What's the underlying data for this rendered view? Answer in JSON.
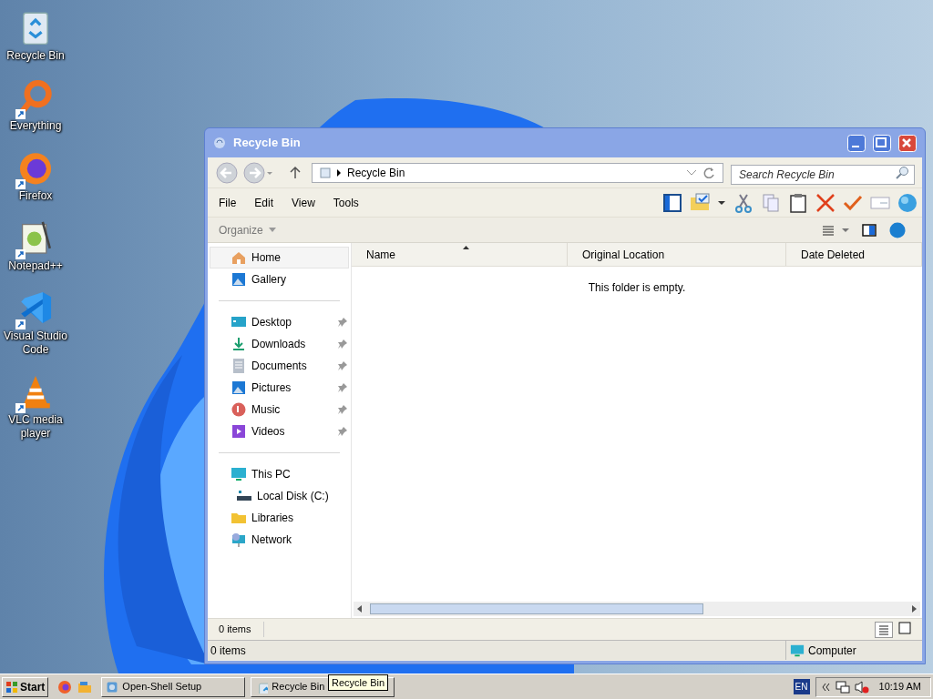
{
  "desktop_icons": [
    {
      "label": "Recycle Bin",
      "kind": "bin",
      "shortcut": false
    },
    {
      "label": "Everything",
      "kind": "magnifier",
      "shortcut": true
    },
    {
      "label": "Firefox",
      "kind": "firefox",
      "shortcut": true
    },
    {
      "label": "Notepad++",
      "kind": "notepad",
      "shortcut": true
    },
    {
      "label": "Visual Studio Code",
      "kind": "vscode",
      "shortcut": true
    },
    {
      "label": "VLC media player",
      "kind": "cone",
      "shortcut": true
    }
  ],
  "window": {
    "title": "Recycle Bin",
    "address": {
      "path": "Recycle Bin"
    },
    "search": {
      "placeholder": "Search Recycle Bin"
    },
    "menu": [
      "File",
      "Edit",
      "View",
      "Tools"
    ],
    "command_bar": {
      "organize": "Organize"
    },
    "nav_groups": [
      [
        {
          "label": "Home",
          "kind": "home",
          "selected": true,
          "pinned": false
        },
        {
          "label": "Gallery",
          "kind": "gallery",
          "selected": false,
          "pinned": false
        }
      ],
      [
        {
          "label": "Desktop",
          "kind": "desktop",
          "selected": false,
          "pinned": true
        },
        {
          "label": "Downloads",
          "kind": "download",
          "selected": false,
          "pinned": true
        },
        {
          "label": "Documents",
          "kind": "doc",
          "selected": false,
          "pinned": true
        },
        {
          "label": "Pictures",
          "kind": "gallery",
          "selected": false,
          "pinned": true
        },
        {
          "label": "Music",
          "kind": "music",
          "selected": false,
          "pinned": true
        },
        {
          "label": "Videos",
          "kind": "video",
          "selected": false,
          "pinned": true
        }
      ],
      [
        {
          "label": "This PC",
          "kind": "pc",
          "selected": false,
          "pinned": false,
          "children": [
            {
              "label": "Local Disk (C:)",
              "kind": "disk",
              "selected": false,
              "pinned": false
            }
          ]
        },
        {
          "label": "Libraries",
          "kind": "folder",
          "selected": false,
          "pinned": false
        },
        {
          "label": "Network",
          "kind": "network",
          "selected": false,
          "pinned": false
        }
      ]
    ],
    "table": {
      "columns": [
        "Name",
        "Original Location",
        "Date Deleted"
      ],
      "empty_message": "This folder is empty."
    },
    "details_status": "0 items",
    "status_bar": {
      "left": "0 items",
      "right": "Computer"
    }
  },
  "taskbar": {
    "start": "Start",
    "buttons": [
      {
        "label": "Open-Shell Setup",
        "kind": "setup",
        "selected": false
      },
      {
        "label": "Recycle Bin",
        "kind": "bin",
        "selected": false
      }
    ],
    "tooltip": "Recycle Bin",
    "language": "EN",
    "time": "10:19 AM"
  }
}
